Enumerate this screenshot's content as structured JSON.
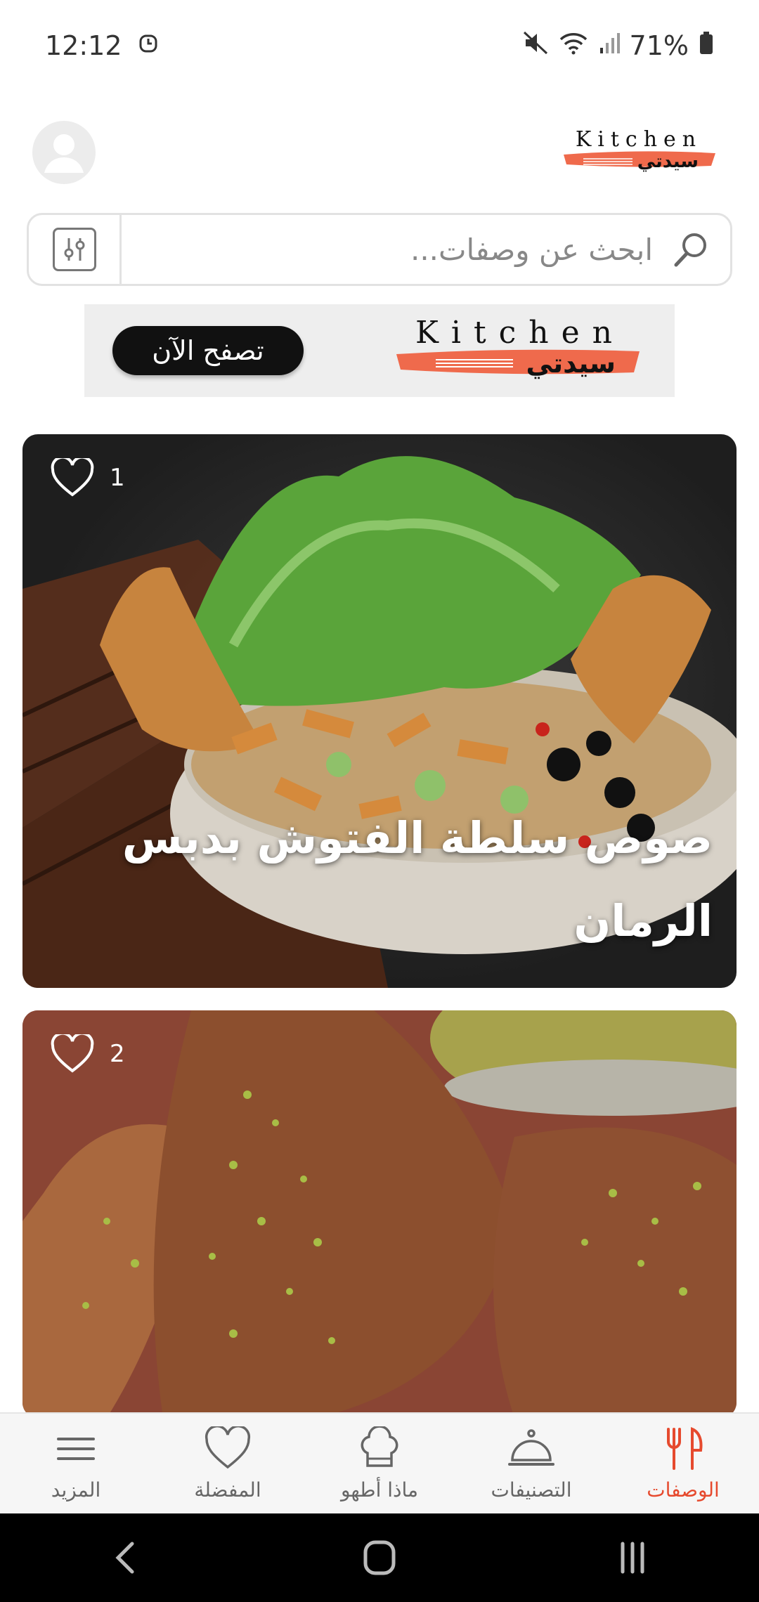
{
  "status_bar": {
    "time": "12:12",
    "battery": "71%"
  },
  "brand": {
    "logo_latin": "Kitchen",
    "logo_arabic": "سيدتي",
    "accent_color": "#e64a2e"
  },
  "search": {
    "placeholder": "ابحث عن وصفات..."
  },
  "banner": {
    "button_label": "تصفح الآن",
    "logo_latin": "Kitchen",
    "logo_arabic": "سيدتي"
  },
  "recipes": [
    {
      "title": "صوص سلطة الفتوش بدبس الرمان",
      "favorites": "1"
    },
    {
      "title": "",
      "favorites": "2"
    }
  ],
  "bottom_nav": {
    "items": [
      {
        "label": "الوصفات",
        "icon": "fork-knife-icon",
        "active": true
      },
      {
        "label": "التصنيفات",
        "icon": "cloche-icon",
        "active": false
      },
      {
        "label": "ماذا أطهو",
        "icon": "chef-hat-icon",
        "active": false
      },
      {
        "label": "المفضلة",
        "icon": "heart-icon",
        "active": false
      },
      {
        "label": "المزيد",
        "icon": "menu-icon",
        "active": false
      }
    ]
  }
}
